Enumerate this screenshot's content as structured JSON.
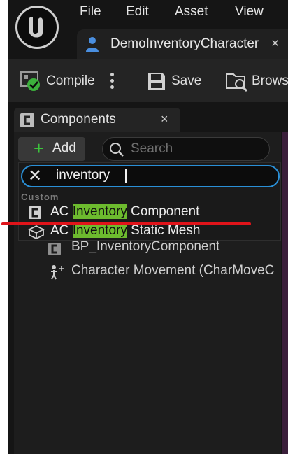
{
  "menu": {
    "file": "File",
    "edit": "Edit",
    "asset": "Asset",
    "view": "View"
  },
  "tab": {
    "label": "DemoInventoryCharacter",
    "close": "×"
  },
  "toolbar": {
    "compile": "Compile",
    "save": "Save",
    "browse": "Brows"
  },
  "components_panel": {
    "title": "Components",
    "close": "×",
    "add_label": "Add",
    "add_symbol": "+",
    "search_placeholder": "Search"
  },
  "add_dropdown": {
    "search_value": "inventory",
    "clear_symbol": "✕",
    "category": "Custom",
    "items": [
      {
        "prefix": "AC ",
        "match": "Inventory",
        "suffix": " Component",
        "icon": "component-icon"
      },
      {
        "prefix": "AC ",
        "match": "Inventory",
        "suffix": " Static Mesh",
        "icon": "static-mesh-icon"
      }
    ]
  },
  "tree": [
    {
      "label": "BP_InventoryComponent",
      "icon": "component-icon"
    },
    {
      "label": "Character Movement (CharMoveC",
      "icon": "character-movement-icon"
    }
  ],
  "colors": {
    "highlight": "#6dbb2e",
    "focus_border": "#2a8fd6",
    "annotation": "#e0141a",
    "add_green": "#3cc43c"
  }
}
